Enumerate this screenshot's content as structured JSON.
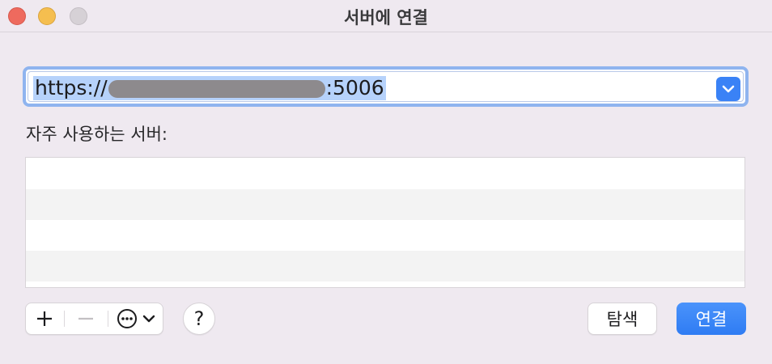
{
  "window": {
    "title": "서버에 연결"
  },
  "address": {
    "prefix": "https://",
    "suffix": ":5006"
  },
  "favorites": {
    "label": "자주 사용하는 서버:",
    "rows": [
      "",
      "",
      "",
      ""
    ]
  },
  "toolbar": {
    "add_icon": "plus-icon",
    "remove_icon": "minus-icon",
    "more_icon": "ellipsis-circle-icon",
    "help_label": "?",
    "browse_label": "탐색",
    "connect_label": "연결"
  },
  "colors": {
    "accent": "#3a82f6",
    "selection": "#b6d2fb",
    "close": "#ee6a5e",
    "minimize": "#f5be4f",
    "zoom_disabled": "#d6d1d6"
  }
}
